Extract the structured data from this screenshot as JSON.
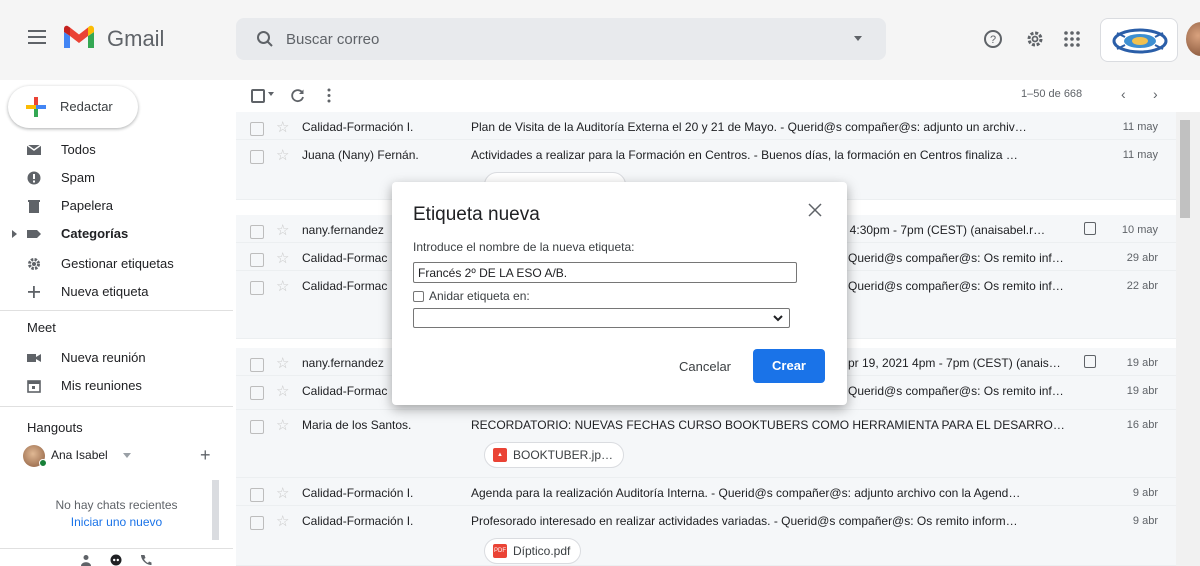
{
  "header": {
    "app_name": "Gmail",
    "search_placeholder": "Buscar correo",
    "icons": [
      "menu-icon",
      "help-icon",
      "settings-icon",
      "apps-icon"
    ]
  },
  "compose": {
    "label": "Redactar"
  },
  "sidebar": {
    "items": [
      {
        "label": "Todos",
        "icon": "mail-icon",
        "bold": false
      },
      {
        "label": "Spam",
        "icon": "spam-icon",
        "bold": false
      },
      {
        "label": "Papelera",
        "icon": "trash-icon",
        "bold": false
      },
      {
        "label": "Categorías",
        "icon": "label-icon",
        "bold": true
      },
      {
        "label": "Gestionar etiquetas",
        "icon": "gear-icon",
        "bold": false
      },
      {
        "label": "Nueva etiqueta",
        "icon": "plus-icon",
        "bold": false
      }
    ],
    "meet": {
      "title": "Meet",
      "items": [
        {
          "label": "Nueva reunión",
          "icon": "video-icon"
        },
        {
          "label": "Mis reuniones",
          "icon": "calendar-icon"
        }
      ]
    },
    "hangouts": {
      "title": "Hangouts",
      "user": "Ana Isabel",
      "no_chats": "No hay chats recientes",
      "start_new": "Iniciar uno nuevo"
    }
  },
  "toolbar": {
    "pagination": "1–50 de 668"
  },
  "emails": [
    {
      "sender": "Calidad-Formación I.",
      "subject": "Plan de Visita de la Auditoría Externa el 20 y 21 de Mayo. - Querid@s compañer@s: adjunto un archiv…",
      "date": "11 may"
    },
    {
      "sender": "Juana (Nany) Fernán.",
      "subject": "Actividades a realizar para la Formación en Centros. - Buenos días, la formación en Centros finaliza …",
      "date": "11 may"
    },
    {
      "sender": "nany.fernandez",
      "subject": "21 4:30pm - 7pm (CEST) (anaisabel.r…",
      "date": "10 may"
    },
    {
      "sender": "Calidad-Formac",
      "subject": "Querid@s compañer@s: Os remito inf…",
      "date": "29 abr"
    },
    {
      "sender": "Calidad-Formac",
      "subject": "Querid@s compañer@s: Os remito inf…",
      "date": "22 abr"
    },
    {
      "sender": "nany.fernandez",
      "subject": "pr 19, 2021 4pm - 7pm (CEST) (anais…",
      "date": "19 abr"
    },
    {
      "sender": "Calidad-Formac",
      "subject": "Querid@s compañer@s: Os remito inf…",
      "date": "19 abr"
    },
    {
      "sender": "Maria de los Santos.",
      "subject": "RECORDATORIO: NUEVAS FECHAS CURSO BOOKTUBERS COMO HERRAMIENTA PARA EL DESARRO…",
      "date": "16 abr",
      "attachment": "BOOKTUBER.jp…"
    },
    {
      "sender": "Calidad-Formación I.",
      "subject": "Agenda para la realización Auditoría Interna. - Querid@s compañer@s: adjunto archivo con la Agend…",
      "date": "9 abr"
    },
    {
      "sender": "Calidad-Formación I.",
      "subject": "Profesorado interesado en realizar actividades variadas. - Querid@s compañer@s: Os remito inform…",
      "date": "9 abr",
      "attachment": "Díptico.pdf"
    }
  ],
  "dialog": {
    "title": "Etiqueta nueva",
    "prompt": "Introduce el nombre de la nueva etiqueta:",
    "input_value": "Francés 2º DE LA ESO A/B.",
    "nest_label": "Anidar etiqueta en:",
    "cancel": "Cancelar",
    "create": "Crear"
  },
  "colors": {
    "accent": "#1a73e8",
    "gmail_red": "#ea4335"
  }
}
